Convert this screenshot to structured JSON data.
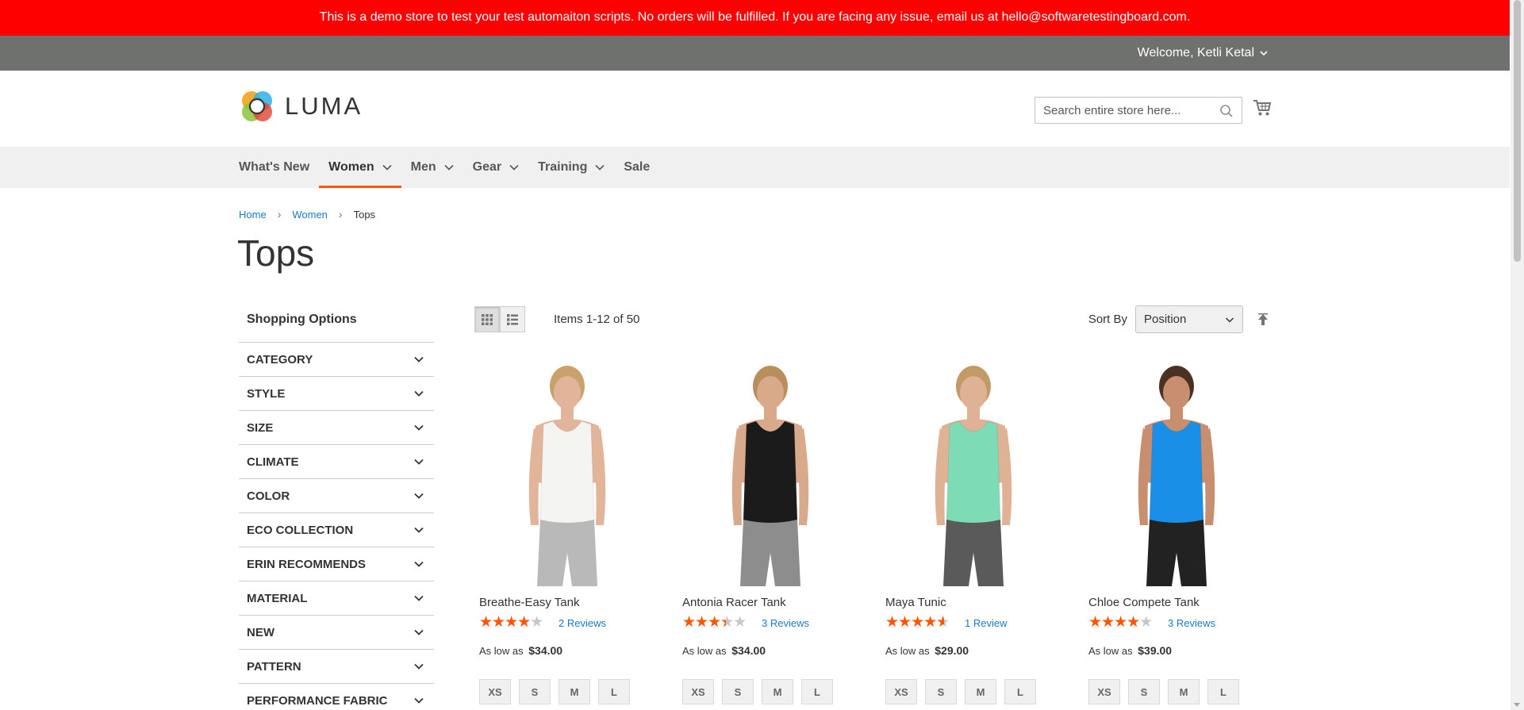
{
  "banner": {
    "text": "This is a demo store to test your test automaiton scripts. No orders will be fulfilled. If you are facing any issue, email us at hello@softwaretestingboard.com."
  },
  "topbar": {
    "welcome": "Welcome, Ketli Ketal"
  },
  "header": {
    "logo_text": "LUMA",
    "search_placeholder": "Search entire store here..."
  },
  "nav": {
    "items": [
      {
        "label": "What's New",
        "has_dropdown": false
      },
      {
        "label": "Women",
        "has_dropdown": true,
        "active": true
      },
      {
        "label": "Men",
        "has_dropdown": true
      },
      {
        "label": "Gear",
        "has_dropdown": true
      },
      {
        "label": "Training",
        "has_dropdown": true
      },
      {
        "label": "Sale",
        "has_dropdown": false
      }
    ]
  },
  "breadcrumb": {
    "home": "Home",
    "women": "Women",
    "current": "Tops"
  },
  "page_title": "Tops",
  "sidebar": {
    "title": "Shopping Options",
    "filters": [
      "CATEGORY",
      "STYLE",
      "SIZE",
      "CLIMATE",
      "COLOR",
      "ECO COLLECTION",
      "ERIN RECOMMENDS",
      "MATERIAL",
      "NEW",
      "PATTERN",
      "PERFORMANCE FABRIC"
    ]
  },
  "toolbar": {
    "items_count": "Items 1-12 of 50",
    "sort_label": "Sort By",
    "sort_value": "Position"
  },
  "products": [
    {
      "name": "Breathe-Easy Tank",
      "rating": 0.7,
      "reviews": "2 Reviews",
      "price_prefix": "As low as",
      "price": "$34.00",
      "sizes": [
        "XS",
        "S",
        "M",
        "L"
      ],
      "colors": {
        "top": "#f4f4f2",
        "bottom": "#b9b9b9",
        "skin": "#e2b59a",
        "hair": "#c9a26b"
      }
    },
    {
      "name": "Antonia Racer Tank",
      "rating": 0.6,
      "reviews": "3 Reviews",
      "price_prefix": "As low as",
      "price": "$34.00",
      "sizes": [
        "XS",
        "S",
        "M",
        "L"
      ],
      "colors": {
        "top": "#1b1b1b",
        "bottom": "#8d8d8d",
        "skin": "#d9a98c",
        "hair": "#b88f5c"
      }
    },
    {
      "name": "Maya Tunic",
      "rating": 0.8,
      "reviews": "1 Review",
      "price_prefix": "As low as",
      "price": "$29.00",
      "sizes": [
        "XS",
        "S",
        "M",
        "L"
      ],
      "colors": {
        "top": "#7ddbb5",
        "bottom": "#5a5a5a",
        "skin": "#e0b295",
        "hair": "#c29a66"
      }
    },
    {
      "name": "Chloe Compete Tank",
      "rating": 0.7,
      "reviews": "3 Reviews",
      "price_prefix": "As low as",
      "price": "$39.00",
      "sizes": [
        "XS",
        "S",
        "M",
        "L"
      ],
      "colors": {
        "top": "#1a8fe8",
        "bottom": "#222222",
        "skin": "#c78e70",
        "hair": "#4a3124"
      }
    }
  ],
  "colors": {
    "banner": "#ff0000",
    "topbar": "#6e716e",
    "accent": "#ff5501",
    "link": "#1979c3"
  }
}
